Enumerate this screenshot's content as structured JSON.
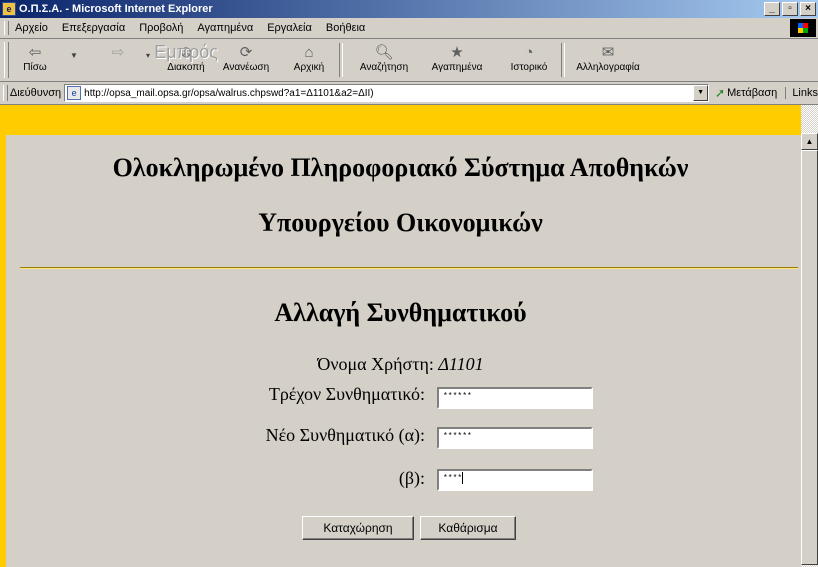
{
  "window": {
    "title": "Ο.Π.Σ.Α. - Microsoft Internet Explorer",
    "minimize": "_",
    "maximize": "▫",
    "close": "×"
  },
  "menu": [
    "Αρχείο",
    "Επεξεργασία",
    "Προβολή",
    "Αγαπημένα",
    "Εργαλεία",
    "Βοήθεια"
  ],
  "toolbar": {
    "back": "Πίσω",
    "forward": "Εμπρός",
    "stop": "Διακοπή",
    "refresh": "Ανανέωση",
    "home": "Αρχική",
    "search": "Αναζήτηση",
    "favorites": "Αγαπημένα",
    "history": "Ιστορικό",
    "mail": "Αλληλογραφία"
  },
  "address": {
    "label": "Διεύθυνση",
    "url": "http://opsa_mail.opsa.gr/opsa/walrus.chpswd?a1=Δ1101&a2=ΔΙΙ)",
    "go": "Μετάβαση",
    "links": "Links"
  },
  "page": {
    "title_line1": "Ολοκληρωμένο Πληροφοριακό Σύστημα Αποθηκών",
    "title_line2": "Υπουργείου Οικονομικών",
    "heading": "Αλλαγή Συνθηματικού",
    "username_label": "Όνομα Χρήστη:",
    "username_value": "Δ1101",
    "current_label": "Τρέχον Συνθηματικό:",
    "current_value": "******",
    "new_a_label": "Νέο Συνθηματικό (α):",
    "new_a_value": "******",
    "new_b_label": "(β):",
    "new_b_value": "****",
    "submit": "Καταχώρηση",
    "reset": "Καθάρισμα"
  },
  "colors": {
    "page_background": "#ffcc00",
    "titlebar_start": "#0a246a",
    "chrome": "#d4d0c8"
  }
}
